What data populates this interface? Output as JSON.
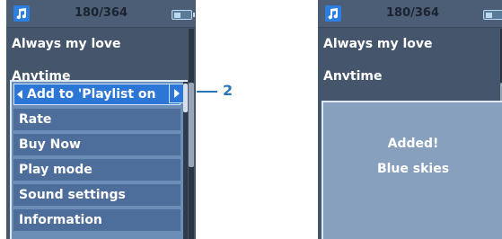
{
  "left_screen": {
    "counter": "180/364",
    "list": [
      "Always my love",
      "Anytime"
    ],
    "menu": {
      "selected": "Add to 'Playlist on",
      "items": [
        "Rate",
        "Buy Now",
        "Play mode",
        "Sound settings",
        "Information"
      ]
    },
    "callout": "2"
  },
  "right_screen": {
    "counter": "180/364",
    "list": [
      "Always my love",
      "Anytime"
    ],
    "message_line1": "Added!",
    "message_line2": "Blue skies"
  },
  "colors": {
    "accent": "#2e75b6",
    "selected_item": "#2c76d6",
    "screen_bg": "#45556b"
  },
  "icons": [
    "music-note-icon",
    "battery-icon",
    "arrow-left-icon",
    "arrow-right-icon"
  ]
}
